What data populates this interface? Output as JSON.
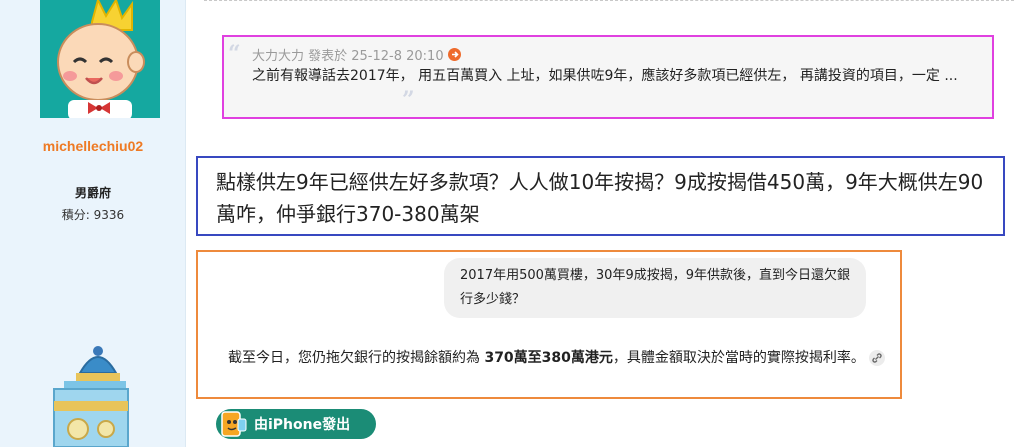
{
  "profile": {
    "username": "michellechiu02",
    "rank": "男爵府",
    "points": "積分: 9336"
  },
  "quote": {
    "author_and_time": "大力大力 發表於 25-12-8 20:10",
    "text": "之前有報導話去2017年， 用五百萬買入 上址，如果供咗9年，應該好多款項已經供左， 再講投資的項目，一定 ..."
  },
  "reply": {
    "text": "點樣供左9年已經供左好多款項？人人做10年按揭？9成按揭借450萬，9年大概供左90萬咋，仲爭銀行370-380萬架"
  },
  "embedded_screenshot": {
    "question": "2017年用500萬買樓，30年9成按揭，9年供款後，直到今日還欠銀行多少錢？",
    "answer_before": "截至今日，您仍拖欠銀行的按揭餘額約為 ",
    "answer_bold": "370萬至380萬港元",
    "answer_after": "，具體金額取決於當時的實際按揭利率。"
  },
  "footer": {
    "badge_label": "由iPhone發出"
  },
  "colors": {
    "username": "#ee7a24",
    "quote_border": "#e040e0",
    "reply_border": "#3848c0",
    "screenshot_border": "#ee8a3c",
    "badge_bg": "#1b8c76"
  }
}
